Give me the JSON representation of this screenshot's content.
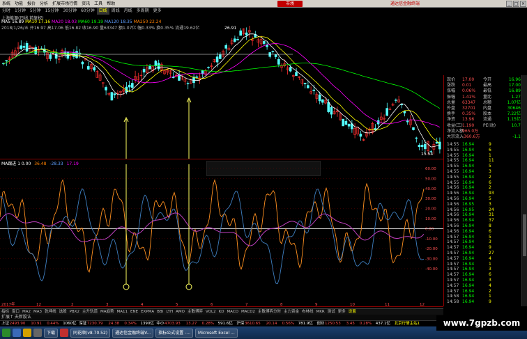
{
  "menu": {
    "items": [
      "系统",
      "功能",
      "报价",
      "分析",
      "扩展市场行情",
      "资讯",
      "工具",
      "帮助"
    ],
    "brand": "市场",
    "brand_right": "通达信金融终端"
  },
  "period_tabs": [
    "分时",
    "1分钟",
    "5分钟",
    "15分钟",
    "30分钟",
    "60分钟",
    "日线",
    "周线",
    "月线",
    "多周期",
    "更多"
  ],
  "period_selected": 6,
  "stock_line": "上海能源(日线,前复权)",
  "ma_line": {
    "text": "MA5 16.89  MA10 17.16  MA20 18.03  MA60 19.19  MA120 18.35  MA250 22.24",
    "colors": [
      "#ffffff",
      "#ffff00",
      "#ff00ff",
      "#00ff00",
      "#5f9fff",
      "#ff8000"
    ]
  },
  "info_line": "2018/1/26/五  开16.97  高17.06  低16.82  收16.90  量63347  额1.07亿  幅0.33%  换0.35%  流通19.62亿",
  "price_labels": {
    "high": "26.91",
    "low": "15.54"
  },
  "indicator_title": {
    "name": "MA跟进 1 0.00",
    "v1": "36.48",
    "v2": "-28.33",
    "v3": "17.19"
  },
  "osc_axis": [
    "60.00",
    "50.00",
    "40.00",
    "30.00",
    "20.00",
    "10.00",
    "0.00",
    "-10.00",
    "-20.00",
    "-30.00",
    "-40.00"
  ],
  "quote_panel": [
    {
      "l1": "现价",
      "v1": "17.00",
      "l2": "今开",
      "v2": "16.96"
    },
    {
      "l1": "涨跌",
      "v1": "0.01",
      "l2": "最高",
      "v2": "17.00"
    },
    {
      "l1": "涨幅",
      "v1": "0.06%",
      "l2": "最低",
      "v2": "16.89"
    },
    {
      "l1": "振幅",
      "v1": "1.41%",
      "l2": "量比",
      "v2": "1.27"
    },
    {
      "l1": "总量",
      "v1": "63347",
      "l2": "总额",
      "v2": "1.07亿"
    },
    {
      "l1": "外盘",
      "v1": "32701",
      "l2": "内盘",
      "v2": "30646"
    },
    {
      "l1": "换手",
      "v1": "0.35%",
      "l2": "股本",
      "v2": "7.22亿"
    },
    {
      "l1": "净资",
      "v1": "13.96",
      "l2": "流通",
      "v2": "1.15亿"
    },
    {
      "l1": "收益(三)",
      "v1": "1.190",
      "l2": "PE(动)",
      "v2": "10.7"
    },
    {
      "l1": "净流入额",
      "v1": "965.0万",
      "l2": "",
      "v2": ""
    },
    {
      "l1": "大宗流入",
      "v1": "-360.6万",
      "l2": "",
      "v2": "-1.1"
    }
  ],
  "ticks": [
    {
      "t": "14:55",
      "p": "16.94",
      "q": "9",
      "f": ""
    },
    {
      "t": "14:55",
      "p": "16.94",
      "q": "6",
      "f": ""
    },
    {
      "t": "14:55",
      "p": "16.94",
      "q": "1",
      "f": ""
    },
    {
      "t": "14:55",
      "p": "16.94",
      "q": "11",
      "f": ""
    },
    {
      "t": "14:55",
      "p": "16.94",
      "q": "5",
      "f": ""
    },
    {
      "t": "14:55",
      "p": "16.94",
      "q": "3",
      "f": ""
    },
    {
      "t": "14:55",
      "p": "16.94",
      "q": "2",
      "f": ""
    },
    {
      "t": "14:55",
      "p": "16.94",
      "q": "6",
      "f": ""
    },
    {
      "t": "14:56",
      "p": "16.94",
      "q": "2",
      "f": ""
    },
    {
      "t": "14:56",
      "p": "16.94",
      "q": "93",
      "f": ""
    },
    {
      "t": "14:56",
      "p": "16.94",
      "q": "5",
      "f": ""
    },
    {
      "t": "14:56",
      "p": "16.95",
      "q": "3",
      "f": ""
    },
    {
      "t": "14:56",
      "p": "16.95",
      "q": "24",
      "f": ""
    },
    {
      "t": "14:56",
      "p": "16.94",
      "q": "31",
      "f": ""
    },
    {
      "t": "14:56",
      "p": "16.94",
      "q": "37",
      "f": ""
    },
    {
      "t": "14:56",
      "p": "16.94",
      "q": "8",
      "f": ""
    },
    {
      "t": "14:56",
      "p": "16.94",
      "q": "6",
      "f": ""
    },
    {
      "t": "14:57",
      "p": "16.94",
      "q": "5",
      "f": ""
    },
    {
      "t": "14:57",
      "p": "16.94",
      "q": "3",
      "f": ""
    },
    {
      "t": "14:57",
      "p": "16.94",
      "q": "9",
      "f": ""
    },
    {
      "t": "14:57",
      "p": "16.94",
      "q": "27",
      "f": ""
    },
    {
      "t": "14:57",
      "p": "16.94",
      "q": "4",
      "f": ""
    },
    {
      "t": "14:57",
      "p": "16.94",
      "q": "1",
      "f": ""
    },
    {
      "t": "14:57",
      "p": "16.94",
      "q": "3",
      "f": ""
    },
    {
      "t": "14:57",
      "p": "16.94",
      "q": "6",
      "f": ""
    },
    {
      "t": "14:57",
      "p": "16.94",
      "q": "3",
      "f": ""
    },
    {
      "t": "14:57",
      "p": "16.94",
      "q": "4",
      "f": ""
    },
    {
      "t": "14:57",
      "p": "16.94",
      "q": "2",
      "f": ""
    },
    {
      "t": "14:58",
      "p": "16.94",
      "q": "1",
      "f": ""
    },
    {
      "t": "14:58",
      "p": "16.94",
      "q": "9",
      "f": ""
    }
  ],
  "date_axis": [
    "2017年",
    "12",
    "2",
    "3",
    "4",
    "5",
    "6",
    "7",
    "8",
    "9",
    "10",
    "11",
    "12"
  ],
  "bottom_tabs": [
    "指标",
    "窗口",
    "MA2",
    "MA3",
    "乾坤线",
    "选股",
    "PBX2",
    "主升轨道",
    "MA趋势",
    "MA11",
    "ENE",
    "EXPMA",
    "BBI",
    "LYH",
    "AMO",
    "主散博弈",
    "VOL2",
    "KD",
    "MACD",
    "MACD2",
    "主散博弈分时",
    "主力资金",
    "布林线",
    "MKR",
    "测试",
    "更多",
    "设置"
  ],
  "bottom_selected": 26,
  "ext_row": "扩展↑  夫新股认",
  "index_bar": [
    {
      "text": "上证",
      "color": "#ffffff"
    },
    {
      "text": "2493.90",
      "color": "#ff5050"
    },
    {
      "text": "10.91",
      "color": "#ff5050"
    },
    {
      "text": "0.44%",
      "color": "#ff5050"
    },
    {
      "text": "1060亿",
      "color": "#ffffff"
    },
    {
      "text": "深证",
      "color": "#ffffff"
    },
    {
      "text": "7230.79",
      "color": "#ff5050"
    },
    {
      "text": "24.38",
      "color": "#ff5050"
    },
    {
      "text": "0.34%",
      "color": "#ff5050"
    },
    {
      "text": "1390亿",
      "color": "#ffffff"
    },
    {
      "text": "中小",
      "color": "#ffffff"
    },
    {
      "text": "4703.93",
      "color": "#ff5050"
    },
    {
      "text": "13.27",
      "color": "#ff5050"
    },
    {
      "text": "0.28%",
      "color": "#ff5050"
    },
    {
      "text": "591.6亿",
      "color": "#ffffff"
    },
    {
      "text": "沪深",
      "color": "#ffffff"
    },
    {
      "text": "3610.65",
      "color": "#ff5050"
    },
    {
      "text": "20.14",
      "color": "#ff5050"
    },
    {
      "text": "0.56%",
      "color": "#ff5050"
    },
    {
      "text": "781.9亿",
      "color": "#ffffff"
    },
    {
      "text": "创业",
      "color": "#ffffff"
    },
    {
      "text": "1250.53",
      "color": "#ff5050"
    },
    {
      "text": "3.45",
      "color": "#ff5050"
    },
    {
      "text": "0.28%",
      "color": "#ff5050"
    },
    {
      "text": "437.1亿",
      "color": "#ffffff"
    },
    {
      "text": "北京行情主站1",
      "color": "#ffff00"
    }
  ],
  "taskbar": [
    "下载",
    "同花顺(v8.70.52)",
    "通达信金融终端V...",
    "指标公式设置 -...",
    "Microsoft Excel ..."
  ],
  "watermark": "www.7gpzb.com"
}
